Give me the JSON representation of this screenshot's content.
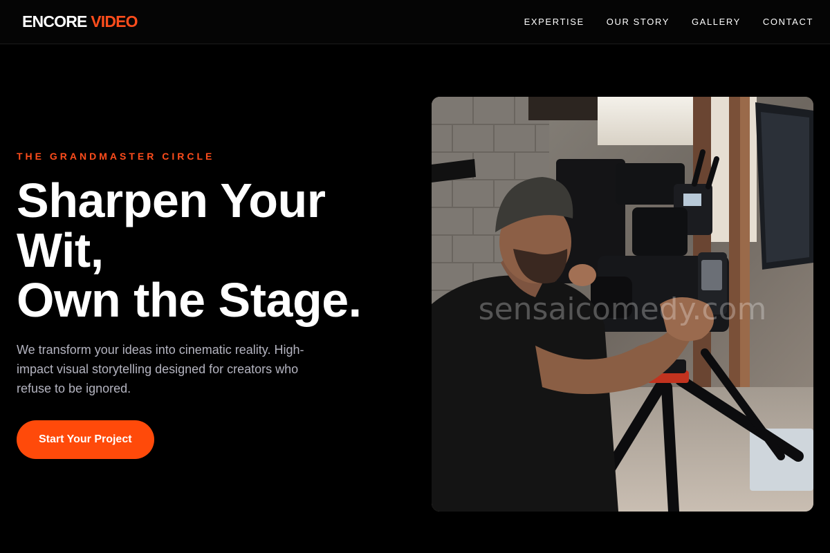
{
  "brand": {
    "name_main": "ENCORE",
    "name_accent": "VIDEO",
    "accent_color": "#ff4d1c"
  },
  "nav": {
    "items": [
      {
        "label": "EXPERTISE"
      },
      {
        "label": "OUR STORY"
      },
      {
        "label": "GALLERY"
      },
      {
        "label": "CONTACT"
      }
    ]
  },
  "hero": {
    "eyebrow": "THE GRANDMASTER CIRCLE",
    "headline_lines": [
      "Sharpen Your",
      "Wit,",
      "Own the Stage."
    ],
    "description": "We transform your ideas into cinematic reality. High-impact visual storytelling designed for creators who refuse to be ignored.",
    "cta_label": "Start Your Project",
    "cta_color": "#ff4a0a"
  },
  "image": {
    "subject": "videographer-operating-camera-on-tripod",
    "watermark": "sensaicomedy.com"
  }
}
